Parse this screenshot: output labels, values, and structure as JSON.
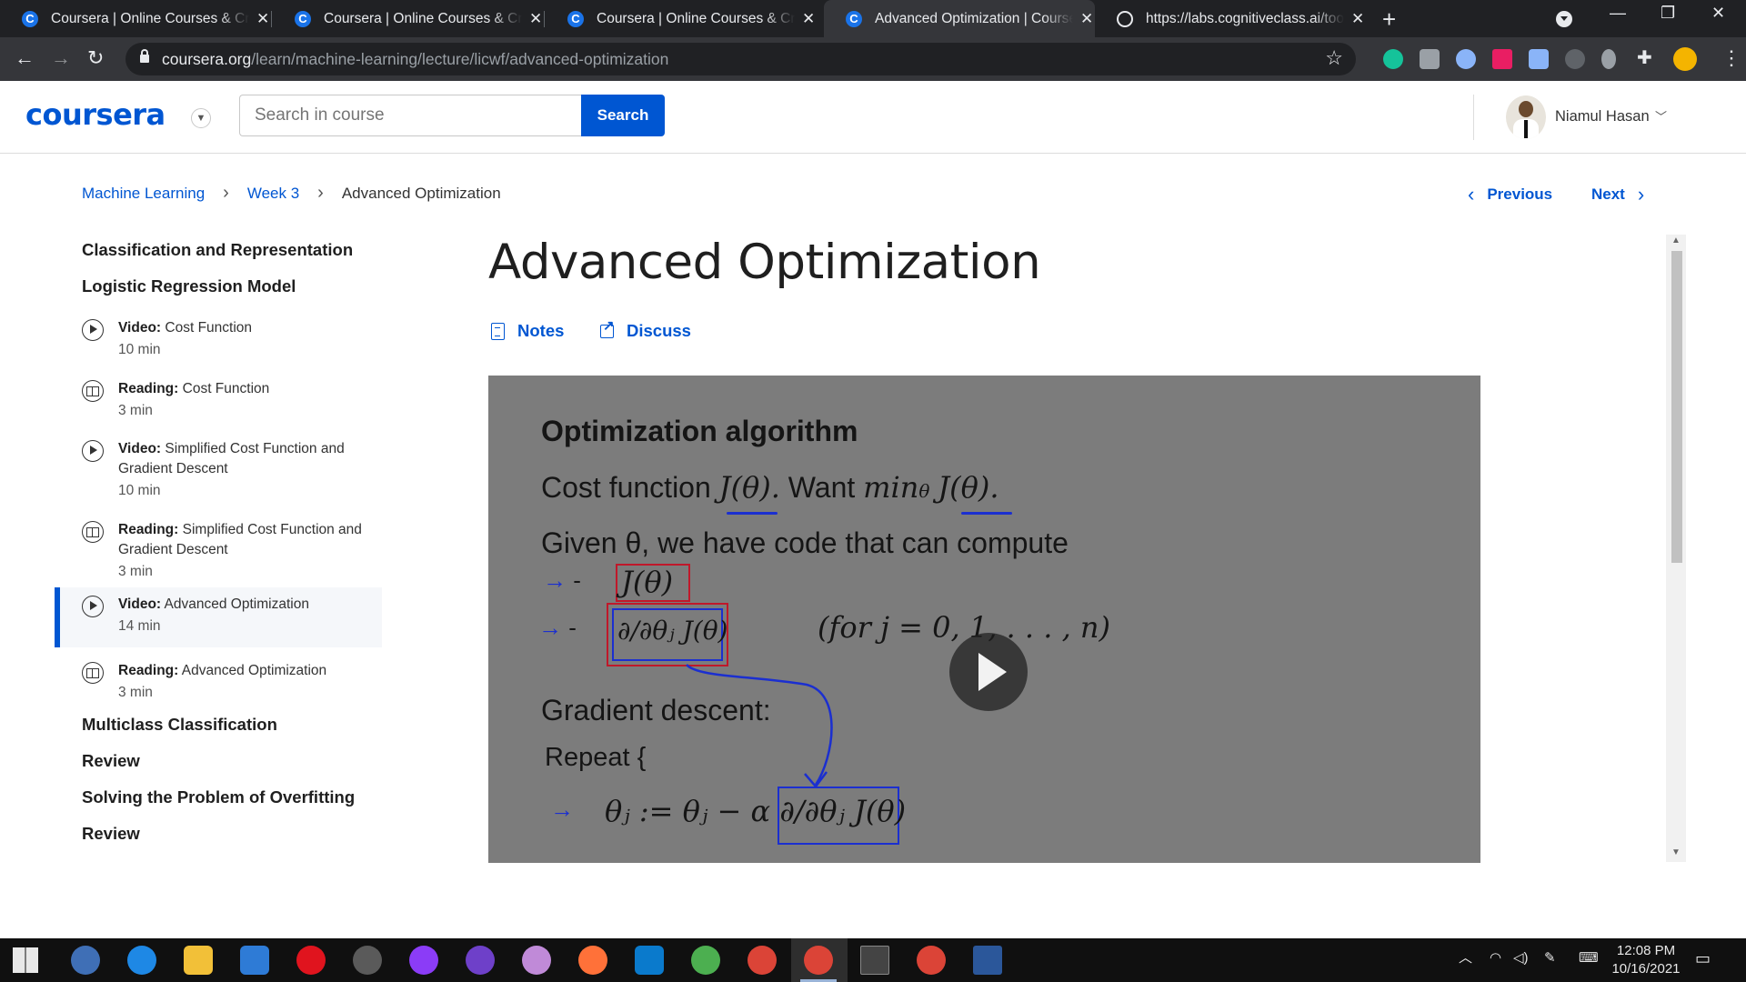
{
  "browser": {
    "tabs": [
      {
        "title": "Coursera | Online Courses & Credentials",
        "active": false,
        "icon": "coursera-icon"
      },
      {
        "title": "Coursera | Online Courses & Credentials",
        "active": false,
        "icon": "coursera-icon"
      },
      {
        "title": "Coursera | Online Courses & Credentials",
        "active": false,
        "icon": "coursera-icon"
      },
      {
        "title": "Advanced Optimization | Coursera",
        "active": true,
        "icon": "coursera-icon"
      },
      {
        "title": "https://labs.cognitiveclass.ai/tools",
        "active": false,
        "icon": "globe-icon"
      }
    ],
    "url_host": "coursera.org",
    "url_path": "/learn/machine-learning/lecture/licwf/advanced-optimization"
  },
  "header": {
    "logo": "coursera",
    "search_placeholder": "Search in course",
    "search_button": "Search",
    "user_name": "Niamul Hasan"
  },
  "breadcrumb": [
    "Machine Learning",
    "Week 3",
    "Advanced Optimization"
  ],
  "nav": {
    "previous": "Previous",
    "next": "Next"
  },
  "sidebar": {
    "sections_top": [
      "Classification and Representation",
      "Logistic Regression Model"
    ],
    "items": [
      {
        "type": "Video:",
        "title": "Cost Function",
        "duration": "10 min",
        "icon": "play-icon"
      },
      {
        "type": "Reading:",
        "title": "Cost Function",
        "duration": "3 min",
        "icon": "book-icon"
      },
      {
        "type": "Video:",
        "title": "Simplified Cost Function and Gradient Descent",
        "duration": "10 min",
        "icon": "play-icon"
      },
      {
        "type": "Reading:",
        "title": "Simplified Cost Function and Gradient Descent",
        "duration": "3 min",
        "icon": "book-icon"
      },
      {
        "type": "Video:",
        "title": "Advanced Optimization",
        "duration": "14 min",
        "icon": "play-icon",
        "active": true
      },
      {
        "type": "Reading:",
        "title": "Advanced Optimization",
        "duration": "3 min",
        "icon": "book-icon"
      }
    ],
    "sections_bottom": [
      "Multiclass Classification",
      "Review",
      "Solving the Problem of Overfitting",
      "Review"
    ]
  },
  "main": {
    "title": "Advanced Optimization",
    "notes_label": "Notes",
    "discuss_label": "Discuss"
  },
  "video_slide": {
    "title": "Optimization algorithm",
    "line1_a": "Cost function",
    "line1_b": "J(θ).",
    "line1_c": "Want",
    "line1_d": "min",
    "line1_e": "θ",
    "line1_f": "J(θ).",
    "line2": "Given θ, we have code that can compute",
    "bullet1": "J(θ)",
    "bullet2": "∂/∂θⱼ J(θ)",
    "for_range": "(for j = 0, 1, . . . , n)",
    "gd_title": "Gradient descent:",
    "repeat": "Repeat {",
    "update": "θⱼ := θⱼ − α ∂/∂θⱼ J(θ)"
  },
  "taskbar": {
    "time": "12:08 PM",
    "date": "10/16/2021"
  },
  "colors": {
    "brand": "#0056d2",
    "chrome_dark": "#202124",
    "chrome_toolbar": "#35363a",
    "ink_red": "#c0182a",
    "ink_blue": "#1b2fd0"
  }
}
